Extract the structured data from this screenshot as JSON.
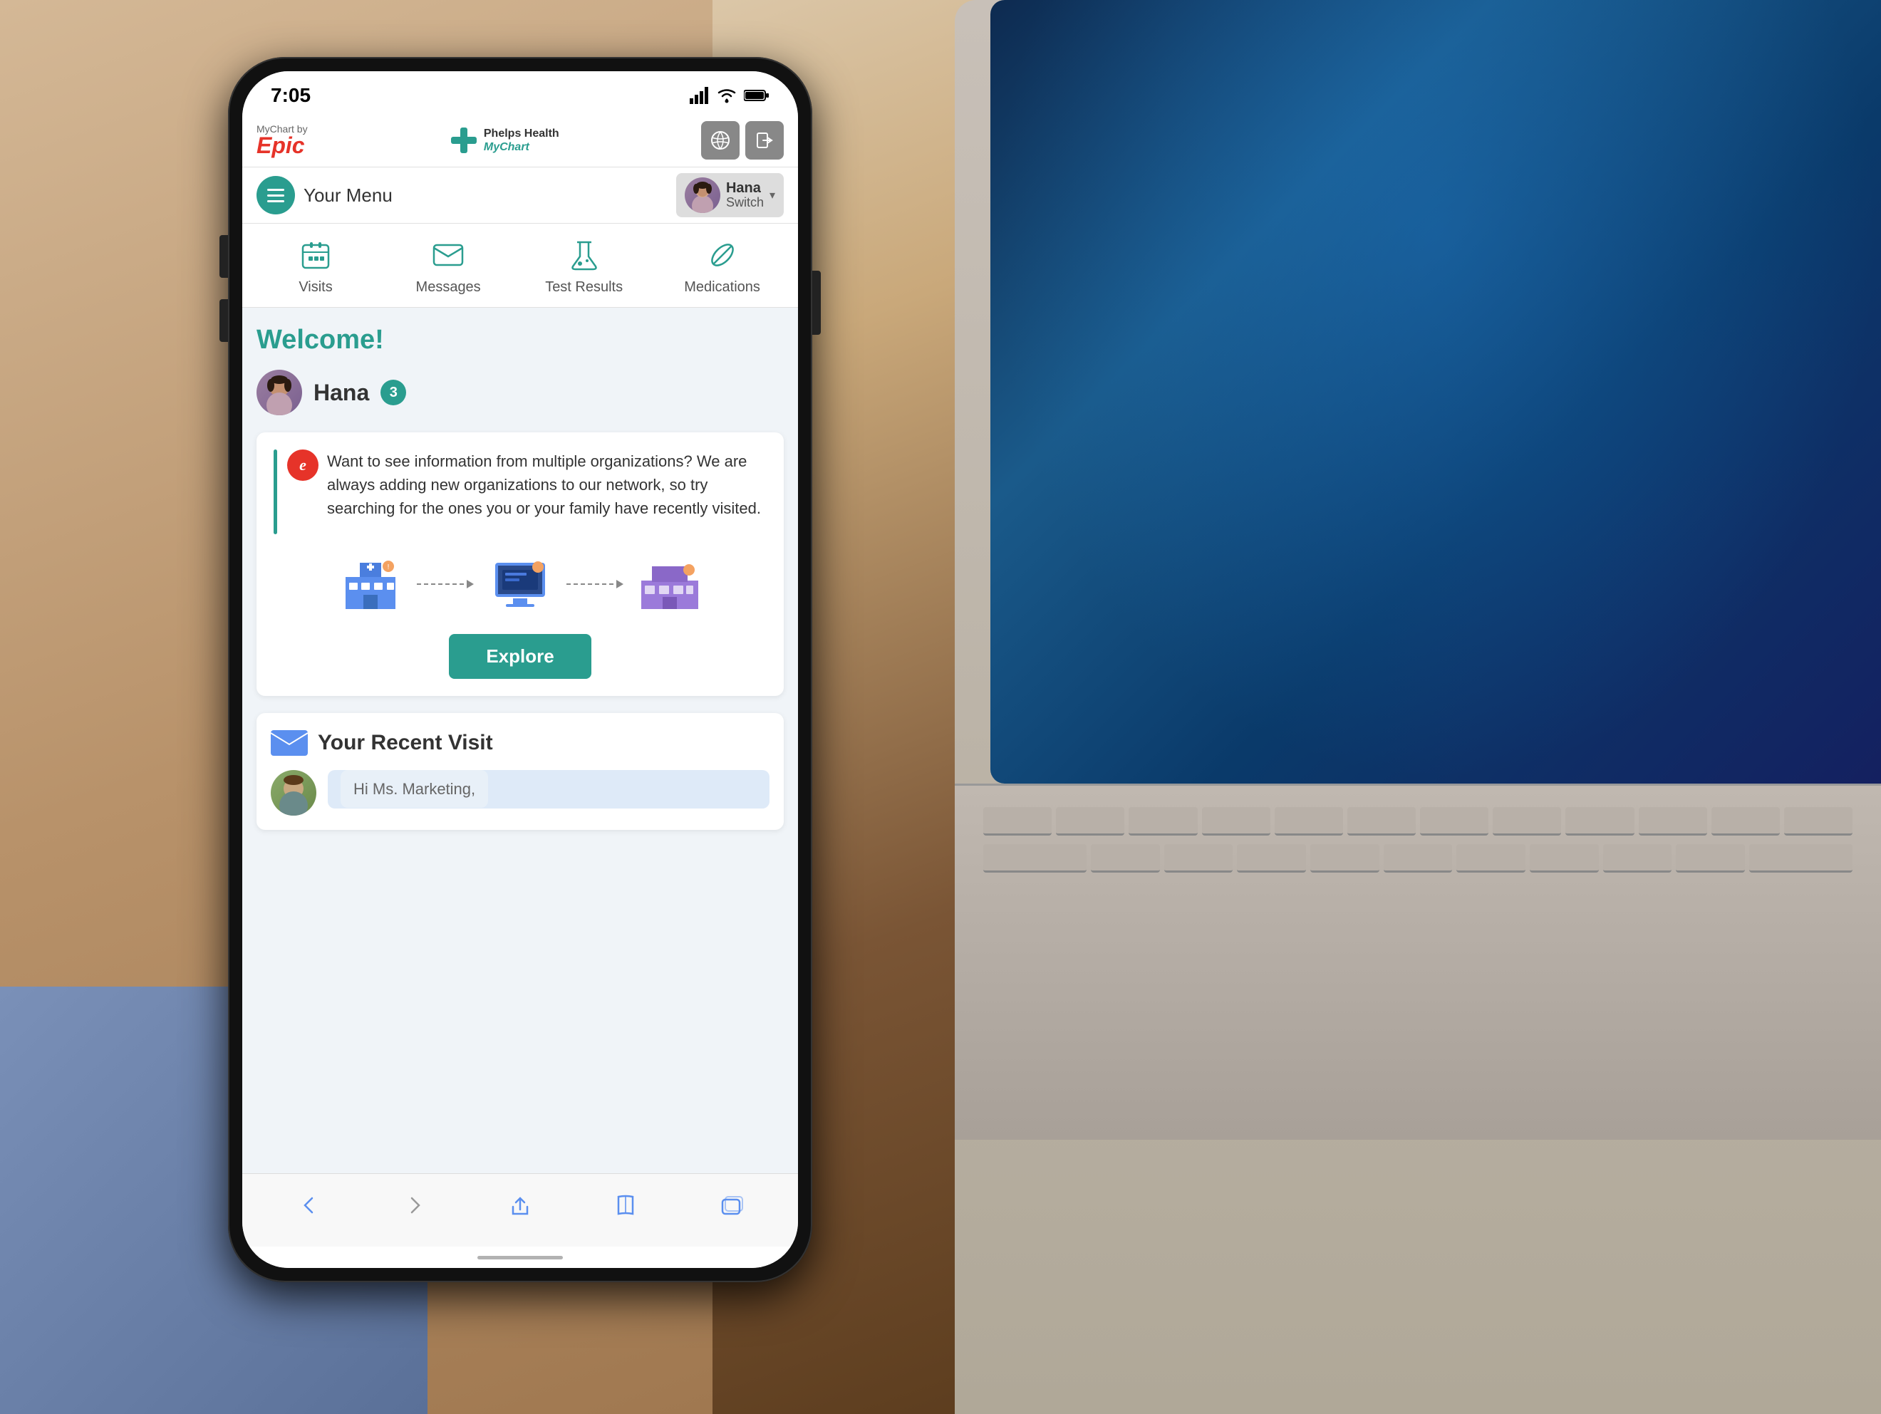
{
  "scene": {
    "bg_desc": "Desk with wood surface, hand holding phone, laptop in background"
  },
  "status_bar": {
    "time": "7:05",
    "signal_bars": "signal",
    "wifi": "wifi",
    "battery": "battery"
  },
  "header": {
    "mychart_label": "MyChart by",
    "epic_brand": "Epic",
    "phelps_health": "Phelps Health",
    "phelps_mychart": "MyChart",
    "globe_icon": "globe",
    "logout_icon": "logout"
  },
  "user_bar": {
    "menu_label": "Your Menu",
    "user_name": "Hana Switch",
    "dropdown_arrow": "▾"
  },
  "quick_nav": {
    "items": [
      {
        "icon": "calendar",
        "label": "Visits"
      },
      {
        "icon": "message",
        "label": "Messages"
      },
      {
        "icon": "flask",
        "label": "Test Results"
      },
      {
        "icon": "pill",
        "label": "Medications"
      }
    ]
  },
  "main": {
    "welcome_title": "Welcome!",
    "user_name": "Hana",
    "notification_count": "3",
    "card": {
      "text": "Want to see information from multiple organizations? We are always adding new organizations to our network, so try searching for the ones you or your family have recently visited.",
      "explore_btn_label": "Explore"
    },
    "recent_visit": {
      "section_title": "Your Recent Visit",
      "visit_preview_text": "Hi Ms. Marketing,"
    }
  },
  "bottom_nav": {
    "back_icon": "back",
    "forward_icon": "forward",
    "share_icon": "share",
    "book_icon": "book",
    "tabs_icon": "tabs"
  }
}
